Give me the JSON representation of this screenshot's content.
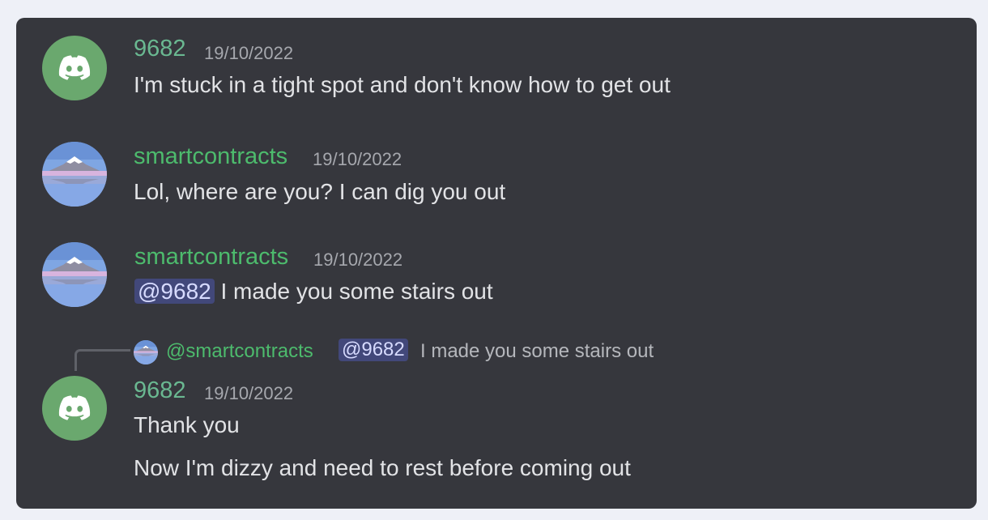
{
  "messages": [
    {
      "username": "9682",
      "timestamp": "19/10/2022",
      "text": "I'm stuck in a tight spot and don't know how to get out",
      "avatar_icon": "discord-logo-icon"
    },
    {
      "username": "smartcontracts",
      "timestamp": "19/10/2022",
      "text": "Lol, where are you? I can dig you out",
      "avatar_icon": "mountain-landscape-avatar"
    },
    {
      "username": "smartcontracts",
      "timestamp": "19/10/2022",
      "mention": "@9682",
      "text": " I made you some stairs out",
      "avatar_icon": "mountain-landscape-avatar"
    },
    {
      "reply": {
        "username": "@smartcontracts",
        "mention": "@9682",
        "text": "I made you some stairs out"
      },
      "username": "9682",
      "timestamp": "19/10/2022",
      "text": "Thank you",
      "text2": "Now I'm dizzy and need to rest before coming out",
      "avatar_icon": "discord-logo-icon"
    }
  ],
  "colors": {
    "background": "#36373d",
    "page": "#eef0f7",
    "username_teal": "#6ab891",
    "username_green": "#4dbb6d",
    "mention_bg": "#42487a",
    "avatar_green": "#6aa86e"
  }
}
